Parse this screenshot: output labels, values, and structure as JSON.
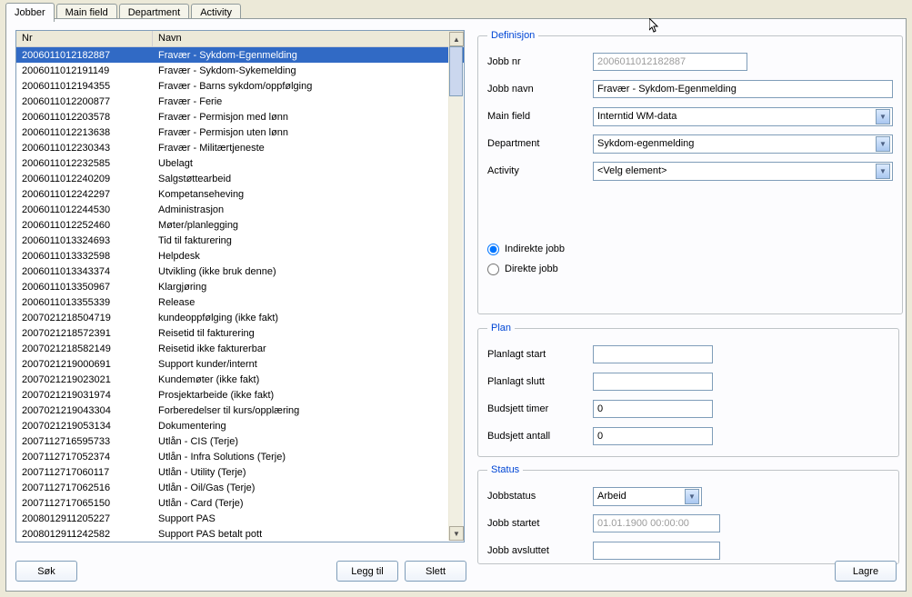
{
  "tabs": [
    "Jobber",
    "Main field",
    "Department",
    "Activity"
  ],
  "active_tab": 0,
  "list": {
    "columns": {
      "nr": "Nr",
      "navn": "Navn"
    },
    "selected": 0,
    "rows": [
      {
        "nr": "2006011012182887",
        "navn": "Fravær - Sykdom-Egenmelding"
      },
      {
        "nr": "2006011012191149",
        "navn": "Fravær - Sykdom-Sykemelding"
      },
      {
        "nr": "2006011012194355",
        "navn": "Fravær - Barns sykdom/oppfølging"
      },
      {
        "nr": "2006011012200877",
        "navn": "Fravær - Ferie"
      },
      {
        "nr": "2006011012203578",
        "navn": "Fravær - Permisjon med lønn"
      },
      {
        "nr": "2006011012213638",
        "navn": "Fravær - Permisjon uten lønn"
      },
      {
        "nr": "2006011012230343",
        "navn": "Fravær - Militærtjeneste"
      },
      {
        "nr": "2006011012232585",
        "navn": "Ubelagt"
      },
      {
        "nr": "2006011012240209",
        "navn": "Salgstøttearbeid"
      },
      {
        "nr": "2006011012242297",
        "navn": "Kompetanseheving"
      },
      {
        "nr": "2006011012244530",
        "navn": "Administrasjon"
      },
      {
        "nr": "2006011012252460",
        "navn": "Møter/planlegging"
      },
      {
        "nr": "2006011013324693",
        "navn": "Tid til fakturering"
      },
      {
        "nr": "2006011013332598",
        "navn": "Helpdesk"
      },
      {
        "nr": "2006011013343374",
        "navn": "Utvikling (ikke bruk denne)"
      },
      {
        "nr": "2006011013350967",
        "navn": "Klargjøring"
      },
      {
        "nr": "2006011013355339",
        "navn": "Release"
      },
      {
        "nr": "2007021218504719",
        "navn": "kundeoppfølging (ikke fakt)"
      },
      {
        "nr": "2007021218572391",
        "navn": "Reisetid til fakturering"
      },
      {
        "nr": "2007021218582149",
        "navn": "Reisetid ikke fakturerbar"
      },
      {
        "nr": "2007021219000691",
        "navn": "Support kunder/internt"
      },
      {
        "nr": "2007021219023021",
        "navn": "Kundemøter (ikke fakt)"
      },
      {
        "nr": "2007021219031974",
        "navn": "Prosjektarbeide (ikke fakt)"
      },
      {
        "nr": "2007021219043304",
        "navn": "Forberedelser til kurs/opplæring"
      },
      {
        "nr": "2007021219053134",
        "navn": "Dokumentering"
      },
      {
        "nr": "2007112716595733",
        "navn": "Utlån - CIS (Terje)"
      },
      {
        "nr": "2007112717052374",
        "navn": "Utlån - Infra Solutions (Terje)"
      },
      {
        "nr": "2007112717060117",
        "navn": "Utlån - Utility (Terje)"
      },
      {
        "nr": "2007112717062516",
        "navn": "Utlån - Oil/Gas (Terje)"
      },
      {
        "nr": "2007112717065150",
        "navn": "Utlån - Card (Terje)"
      },
      {
        "nr": "2008012911205227",
        "navn": "Support PAS"
      },
      {
        "nr": "2008012911242582",
        "navn": "Support PAS betalt pott"
      }
    ]
  },
  "definition": {
    "legend": "Definisjon",
    "labels": {
      "jobbnr": "Jobb nr",
      "jobbnavn": "Jobb navn",
      "mainfield": "Main field",
      "department": "Department",
      "activity": "Activity"
    },
    "values": {
      "jobbnr": "2006011012182887",
      "jobbnavn": "Fravær - Sykdom-Egenmelding",
      "mainfield": "Interntid WM-data",
      "department": "Sykdom-egenmelding",
      "activity": "<Velg element>"
    },
    "radios": {
      "indirekte": "Indirekte jobb",
      "direkte": "Direkte jobb",
      "selected": "indirekte"
    }
  },
  "plan": {
    "legend": "Plan",
    "labels": {
      "start": "Planlagt start",
      "slutt": "Planlagt slutt",
      "timer": "Budsjett timer",
      "antall": "Budsjett antall"
    },
    "values": {
      "start": "",
      "slutt": "",
      "timer": "0",
      "antall": "0"
    }
  },
  "status": {
    "legend": "Status",
    "labels": {
      "jobbstatus": "Jobbstatus",
      "startet": "Jobb startet",
      "avsluttet": "Jobb avsluttet"
    },
    "values": {
      "jobbstatus": "Arbeid",
      "startet": "01.01.1900 00:00:00",
      "avsluttet": ""
    }
  },
  "buttons": {
    "sok": "Søk",
    "leggtil": "Legg til",
    "slett": "Slett",
    "lagre": "Lagre"
  }
}
